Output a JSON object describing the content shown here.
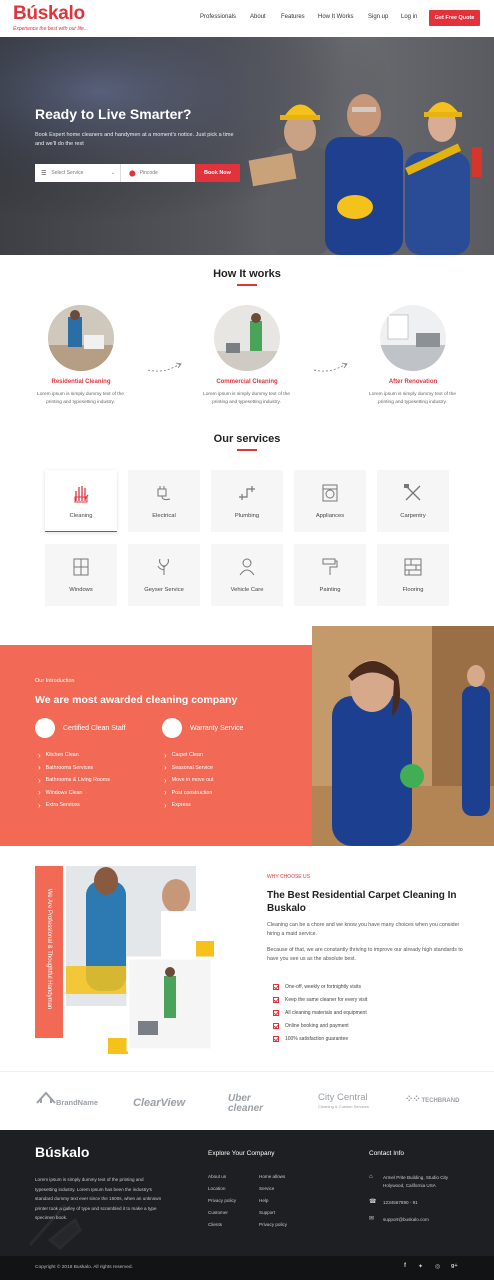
{
  "header": {
    "logo": "Búskalo",
    "tagline": "Experience the best with our life...",
    "nav": [
      "Professionals",
      "About",
      "Features",
      "How It Works",
      "Sign up",
      "Log in"
    ],
    "cta": "Get Free Quote"
  },
  "hero": {
    "title": "Ready to Live Smarter?",
    "subtitle": "Book Expert home cleaners and handymen at a moment's notice. Just pick a time and we'll do the rest",
    "select_placeholder": "Select Service",
    "pincode_placeholder": "Pincode",
    "book_label": "Book Now"
  },
  "how": {
    "title": "How It works",
    "steps": [
      {
        "title": "Residential Cleaning",
        "desc": "Lorem ipsum is simply dummy text of the printing and typesetting industry."
      },
      {
        "title": "Commercial Cleaning",
        "desc": "Lorem ipsum is simply dummy text of the printing and typesetting industry."
      },
      {
        "title": "After Renovation",
        "desc": "Lorem ipsum is simply dummy text of the printing and typesetting industry."
      }
    ]
  },
  "services": {
    "title": "Our services",
    "items": [
      {
        "label": "Cleaning",
        "icon": "glove-icon"
      },
      {
        "label": "Electrical",
        "icon": "plug-icon"
      },
      {
        "label": "Plumbing",
        "icon": "pipe-icon"
      },
      {
        "label": "Appliances",
        "icon": "washing-machine-icon"
      },
      {
        "label": "Carpentry",
        "icon": "tools-icon"
      },
      {
        "label": "Windows",
        "icon": "window-icon"
      },
      {
        "label": "Geyser Service",
        "icon": "geyser-icon"
      },
      {
        "label": "Vehicle Care",
        "icon": "vehicle-icon"
      },
      {
        "label": "Painting",
        "icon": "paint-roller-icon"
      },
      {
        "label": "Flooring",
        "icon": "floor-icon"
      }
    ]
  },
  "intro": {
    "eyebrow": "Our Introduction",
    "title": "We are most awarded cleaning company",
    "badge1": "Certified Clean Staff",
    "badge2": "Warranty Service",
    "list1": [
      "Kitchen Clean",
      "Bathrooms Services",
      "Bathrooms & Living Rooms",
      "Windows Clean",
      "Extra Services"
    ],
    "list2": [
      "Carpet Clean",
      "Seasonal Service",
      "Move in move out",
      "Post construction",
      "Express"
    ]
  },
  "why": {
    "vertical": "We Are Professional & Thoughtful Handyman",
    "eyebrow": "WHY CHOOSE US",
    "title": "The Best Residential Carpet Cleaning In Buskalo",
    "p1": "Cleaning can be a chore and we know you have many choices when you consider hiring a maid service.",
    "p2": "Because of that, we are constantly thriving to improve our already high standards to have you see us as the absolute best.",
    "checks": [
      "One-off, weekly or fortnightly visits",
      "Keep the same cleaner for every visit",
      "All cleaning materials and equipment",
      "Online booking and payment",
      "100% satisfaction guarantee"
    ]
  },
  "brands": [
    "BrandName",
    "ClearView",
    "Uber cleaner",
    "City Central",
    "TECHBRAND"
  ],
  "brand_sub": "Cleaning & Custom Services",
  "footer": {
    "logo": "Búskalo",
    "about": "Lorem ipsum is simply dummy text of the printing and typesetting industry. Lorem Ipsum has been the industry's standard dummy text ever since the 1500s, when an unknown printer took a galley of type and scrambled it to make a type specimen book.",
    "explore_title": "Explore Your Company",
    "col1": [
      "About us",
      "Location",
      "Privacy policy",
      "Customer",
      "Clients"
    ],
    "col2": [
      "Home allows",
      "Service",
      "Help",
      "Support",
      "Privacy policy"
    ],
    "contact_title": "Contact Info",
    "address": "Armel Prite Building, Studio City Holywood, California USA",
    "phone": "1234567890 - 91",
    "email": "support@buskalo.com",
    "copyright": "Copyright © 2018 Buskalo. All rights reserved."
  },
  "colors": {
    "accent": "#e2333d",
    "intro_bg": "#f26a55",
    "footer_bg": "#1e1f22"
  }
}
